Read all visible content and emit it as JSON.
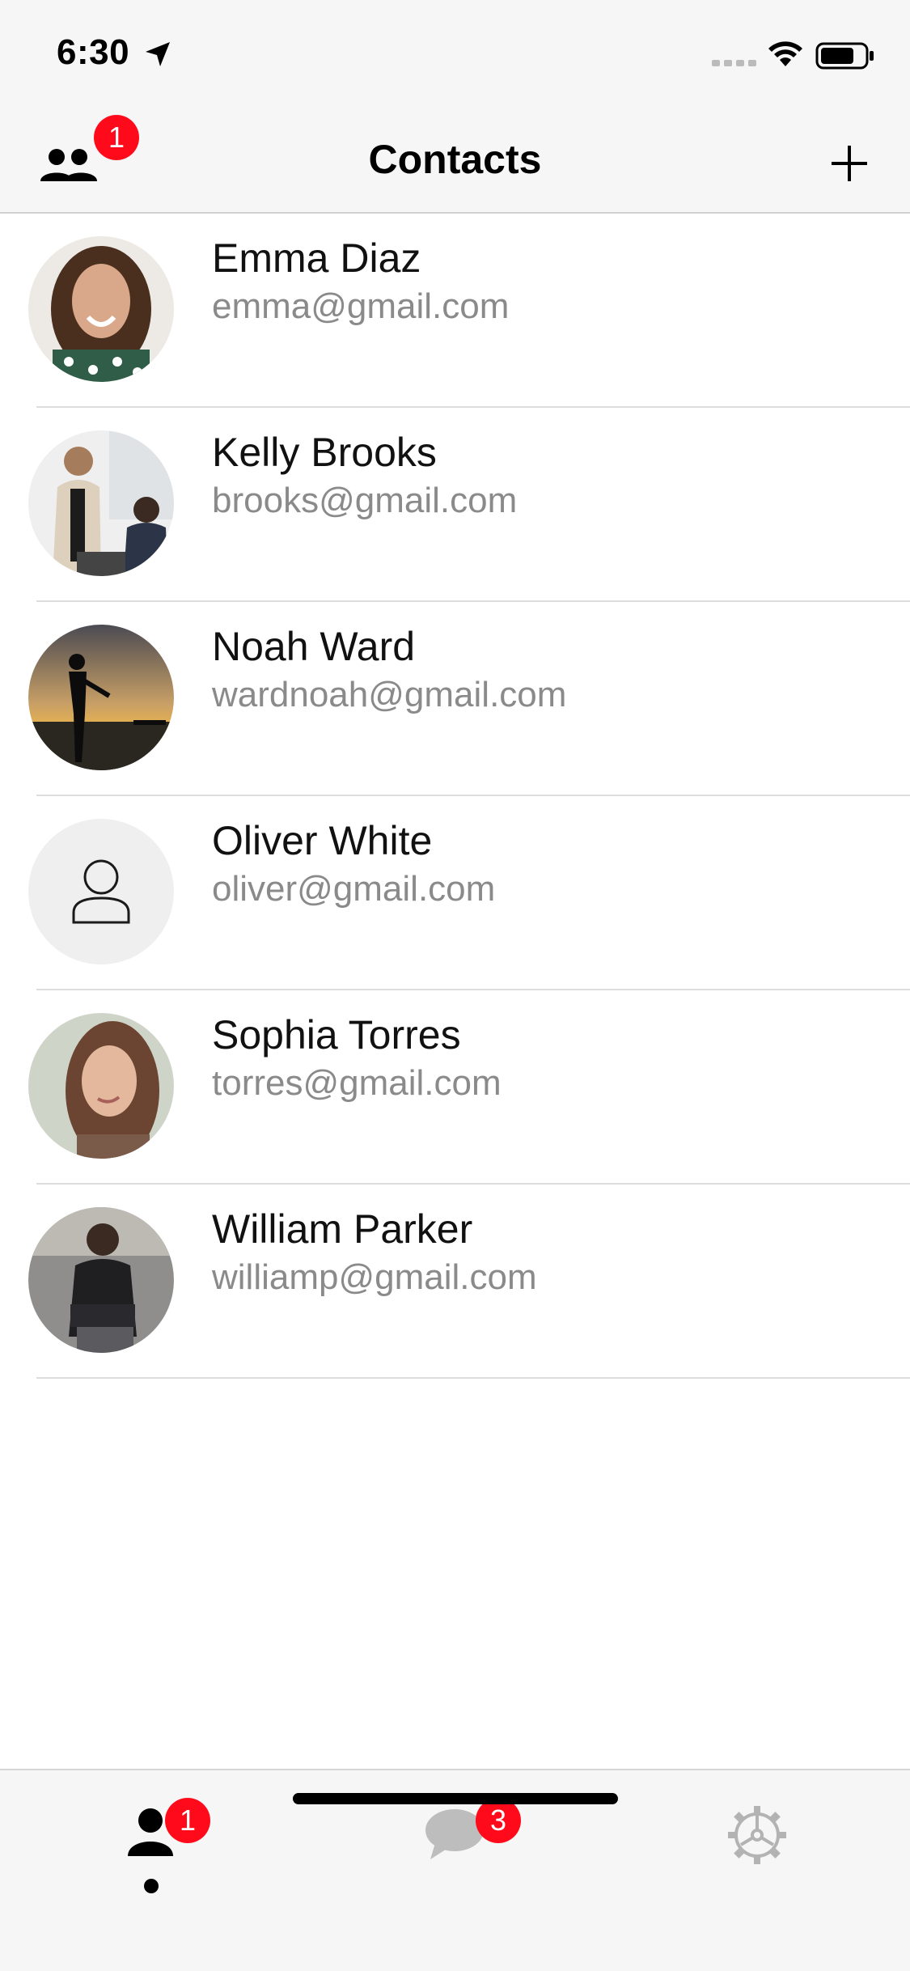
{
  "status_bar": {
    "time": "6:30"
  },
  "nav": {
    "title": "Contacts",
    "group_badge": "1"
  },
  "contacts": [
    {
      "name": "Emma Diaz",
      "email": "emma@gmail.com",
      "avatar": "photo-woman-curly-hair"
    },
    {
      "name": "Kelly Brooks",
      "email": "brooks@gmail.com",
      "avatar": "photo-office-women"
    },
    {
      "name": "Noah Ward",
      "email": "wardnoah@gmail.com",
      "avatar": "photo-silhouette-sunset"
    },
    {
      "name": "Oliver White",
      "email": "oliver@gmail.com",
      "avatar": "placeholder-person-icon"
    },
    {
      "name": "Sophia Torres",
      "email": "torres@gmail.com",
      "avatar": "photo-woman-portrait"
    },
    {
      "name": "William Parker",
      "email": "williamp@gmail.com",
      "avatar": "photo-man-sitting"
    }
  ],
  "tabs": {
    "contacts_badge": "1",
    "chats_badge": "3"
  },
  "colors": {
    "badge": "#ff0a1a",
    "bar_background": "#f6f6f6",
    "email_text": "#8a8a8a"
  }
}
